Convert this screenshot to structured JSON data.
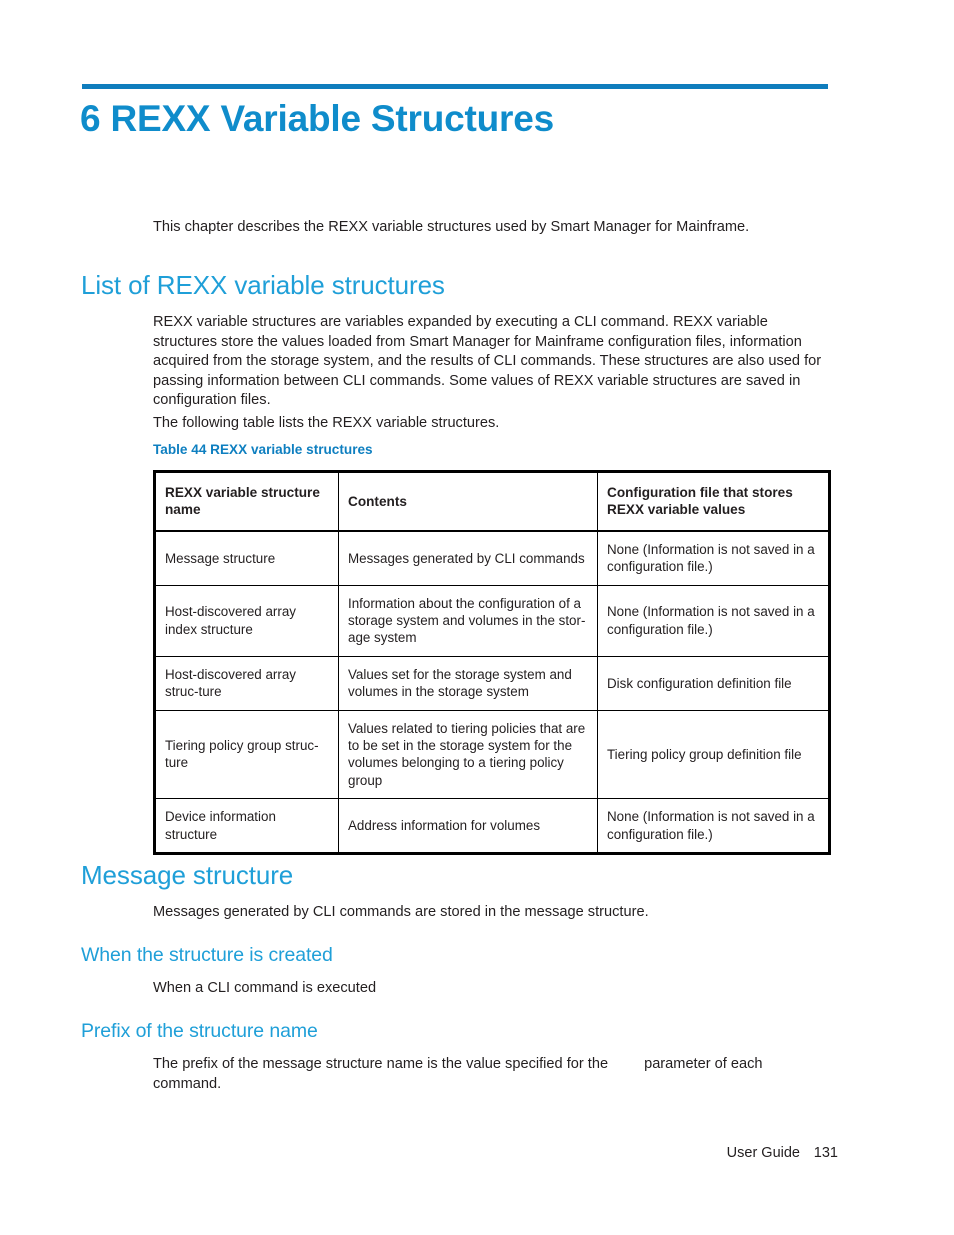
{
  "chapter": {
    "title": "6 REXX Variable Structures",
    "intro": "This chapter describes the REXX variable structures used by Smart Manager for Mainframe.",
    "rule_color": "#0f7dbd",
    "title_color": "#0f8ccb"
  },
  "section_list": {
    "heading": "List of REXX variable structures",
    "paragraph_1": "REXX variable structures are variables expanded by executing a CLI command. REXX variable structures store the values loaded from Smart Manager for Mainframe configuration files, information acquired from the storage system, and the results of CLI commands. These structures are also used for passing information between CLI commands. Some values of REXX variable structures are saved in configuration files.",
    "paragraph_2": "The following table lists the REXX variable structures."
  },
  "table": {
    "caption": "Table 44 REXX variable structures",
    "caption_color": "#0e7fc0",
    "columns": [
      "REXX variable structure name",
      "Contents",
      "Configuration file that stores REXX variable values"
    ],
    "rows": [
      {
        "name": "Message structure",
        "contents": "Messages generated by CLI commands",
        "config_file": "None (Information is not saved in a configuration file.)"
      },
      {
        "name": "Host-discovered array index structure",
        "contents": "Information about the configuration of a storage system and volumes in the stor-age system",
        "config_file": "None (Information is not saved in a configuration file.)"
      },
      {
        "name": "Host-discovered array struc-ture",
        "contents": "Values set for the storage system and volumes in the storage system",
        "config_file": "Disk configuration definition file"
      },
      {
        "name": "Tiering policy group struc-ture",
        "contents": "Values related to tiering policies that are to be set in the storage system for the volumes belonging to a tiering policy group",
        "config_file": "Tiering policy group definition file"
      },
      {
        "name": "Device information structure",
        "contents": "Address information for volumes",
        "config_file": "None (Information is not saved in a configuration file.)"
      }
    ]
  },
  "section_message": {
    "heading": "Message structure",
    "paragraph": "Messages generated by CLI commands are stored in the message structure.",
    "sub_created": {
      "heading": "When the structure is created",
      "paragraph": "When a CLI command is executed"
    },
    "sub_prefix": {
      "heading": "Prefix of the structure name",
      "paragraph_before": "The prefix of the message structure name is the value specified for the",
      "paragraph_after": "parameter of each command."
    }
  },
  "footer": {
    "label": "User Guide",
    "page_number": "131"
  }
}
